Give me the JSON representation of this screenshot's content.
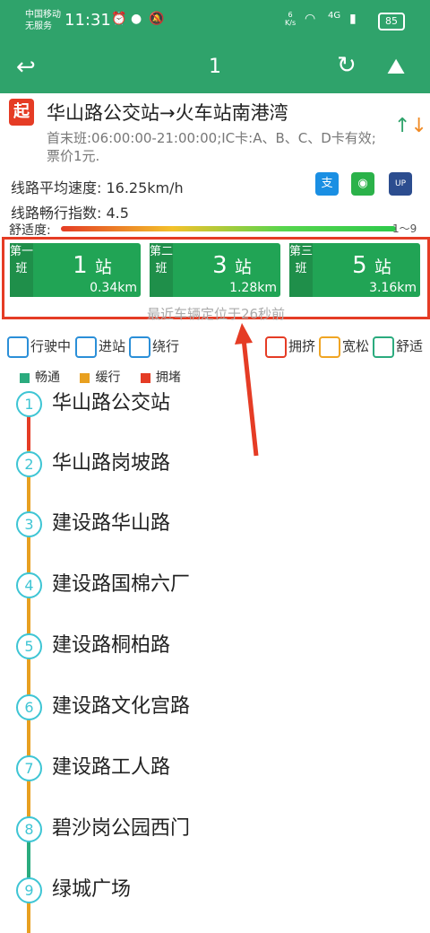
{
  "status_bar": {
    "carrier": "中国移动",
    "service": "无服务",
    "time": "11:31",
    "net_speed_value": "6",
    "net_speed_unit": "K/s",
    "network": "4G",
    "battery": "85"
  },
  "nav": {
    "title": "1",
    "back_icon": "back-arrow-icon",
    "refresh_icon": "refresh-icon",
    "map_icon": "map-icon"
  },
  "route": {
    "start_badge": "起",
    "name": "华山路公交站→火车站南港湾",
    "info": "首末班:06:00:00-21:00:00;IC卡:A、B、C、D卡有效;票价1元.",
    "avg_speed": "线路平均速度: 16.25km/h",
    "smooth_index": "线路畅行指数: 4.5",
    "comfort_label": "舒适度:",
    "comfort_range": "1～9",
    "pay_methods": [
      "alipay-icon",
      "wechat-pay-icon",
      "unionpay-icon"
    ]
  },
  "next_buses": [
    {
      "tag": "第一班",
      "stations": "1",
      "unit": "站",
      "distance": "0.34km"
    },
    {
      "tag": "第二班",
      "stations": "3",
      "unit": "站",
      "distance": "1.28km"
    },
    {
      "tag": "第三班",
      "stations": "5",
      "unit": "站",
      "distance": "3.16km"
    }
  ],
  "located_text": "最近车辆定位于26秒前",
  "legend": {
    "running": "行驶中",
    "entering": "进站",
    "detour": "绕行",
    "crowded": "拥挤",
    "spacious": "宽松",
    "comfortable": "舒适",
    "smooth": "畅通",
    "slow": "缓行",
    "jam": "拥堵"
  },
  "colors": {
    "header": "#2fa36b",
    "smooth": "#2bab7e",
    "slow": "#e8a020",
    "jam": "#e53c25",
    "stop_ring": "#3ec5d4",
    "highlight": "#e53c25"
  },
  "stops": [
    {
      "num": "1",
      "name": "华山路公交站"
    },
    {
      "num": "2",
      "name": "华山路岗坡路"
    },
    {
      "num": "3",
      "name": "建设路华山路"
    },
    {
      "num": "4",
      "name": "建设路国棉六厂"
    },
    {
      "num": "5",
      "name": "建设路桐柏路"
    },
    {
      "num": "6",
      "name": "建设路文化宫路"
    },
    {
      "num": "7",
      "name": "建设路工人路"
    },
    {
      "num": "8",
      "name": "碧沙岗公园西门"
    },
    {
      "num": "9",
      "name": "绿城广场"
    }
  ]
}
